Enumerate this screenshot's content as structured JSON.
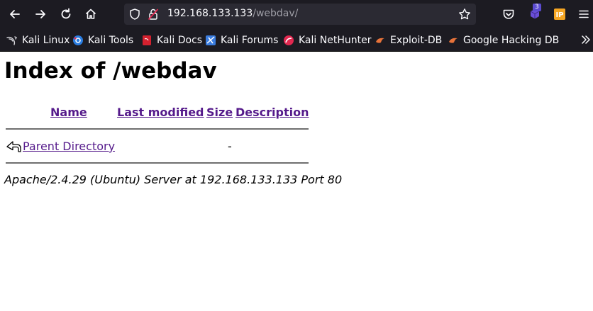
{
  "browser": {
    "url_host": "192.168.133.133",
    "url_path": "/webdav/",
    "extension_badge": "3"
  },
  "bookmarks": [
    {
      "label": "Kali Linux",
      "icon": "kali-dragon-icon"
    },
    {
      "label": "Kali Tools",
      "icon": "kali-tools-icon"
    },
    {
      "label": "Kali Docs",
      "icon": "kali-docs-icon"
    },
    {
      "label": "Kali Forums",
      "icon": "kali-forums-icon"
    },
    {
      "label": "Kali NetHunter",
      "icon": "kali-nethunter-icon"
    },
    {
      "label": "Exploit-DB",
      "icon": "exploit-db-icon"
    },
    {
      "label": "Google Hacking DB",
      "icon": "ghdb-icon"
    }
  ],
  "page": {
    "title": "Index of /webdav",
    "columns": {
      "name": "Name",
      "last_modified": "Last modified",
      "size": "Size",
      "description": "Description"
    },
    "rows": [
      {
        "name": "Parent Directory",
        "last_modified": "",
        "size": "-",
        "description": ""
      }
    ],
    "footer": "Apache/2.4.29 (Ubuntu) Server at 192.168.133.133 Port 80"
  },
  "colors": {
    "chrome_bg": "#1c1b22",
    "urlbar_bg": "#2b2a33",
    "visited_link": "#551a8b"
  }
}
